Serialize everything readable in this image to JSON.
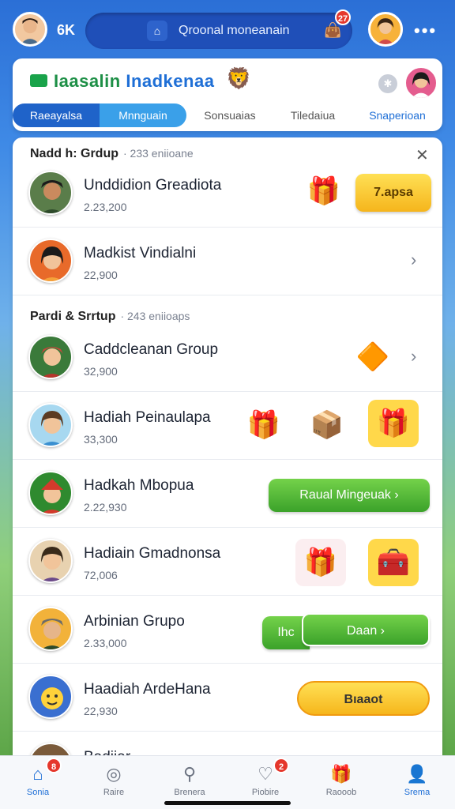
{
  "topbar": {
    "count": "6K",
    "search_text": "Qroonal moneanain",
    "bag_badge": "27"
  },
  "header": {
    "title_green": "Iaasalin",
    "title_blue": " Inadkenaa"
  },
  "tabs": [
    "Raeayalsa",
    "Mnnguain",
    "Sonsuaias",
    "Tiledaiua",
    "Snaperioan"
  ],
  "sections": [
    {
      "title": "Nadd h: Grdup",
      "meta": "·  233 eniioane"
    },
    {
      "title": "Pardi & Srrtup",
      "meta": "·  243 eniioaps"
    }
  ],
  "rows": [
    {
      "name": "Unddidion Greadiota",
      "sub": "2.23,200",
      "action": "7.apsa"
    },
    {
      "name": "Madkist Vindialni",
      "sub": "22,900"
    },
    {
      "name": "Caddcleanan Group",
      "sub": "32,900"
    },
    {
      "name": "Hadiah Peinaulapa",
      "sub": "33,300"
    },
    {
      "name": "Hadkah Mbopua",
      "sub": "2.22,930",
      "action": "Raual Mingeuak"
    },
    {
      "name": "Hadiain Gmadnonsa",
      "sub": "72,006"
    },
    {
      "name": "Arbinian Grupo",
      "sub": "2.33,000",
      "action_left": "Ihc",
      "action": "Daan"
    },
    {
      "name": "Haadiah ArdeHana",
      "sub": "22,930",
      "action": "Bıaaot"
    },
    {
      "name": "Badiiar"
    }
  ],
  "nav": [
    {
      "label": "Sonia",
      "icon": "home-icon",
      "badge": "8"
    },
    {
      "label": "Raire",
      "icon": "compass-icon"
    },
    {
      "label": "Brenera",
      "icon": "search-icon"
    },
    {
      "label": "Piobire",
      "icon": "heart-icon",
      "badge": "2"
    },
    {
      "label": "Raooob",
      "icon": "gift-icon"
    },
    {
      "label": "Srema",
      "icon": "user-icon"
    }
  ],
  "colors": {
    "brand_blue": "#1f6fd6",
    "brand_green": "#1d8f46",
    "accent_yellow": "#ffd84a",
    "badge_red": "#e5372c"
  }
}
